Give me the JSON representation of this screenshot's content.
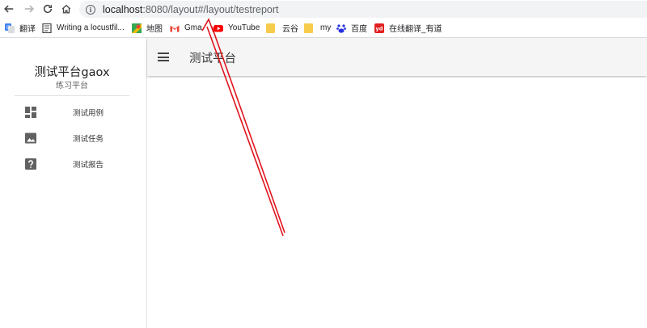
{
  "browser": {
    "url_host": "localhost",
    "url_rest": ":8080/layout#/layout/testreport",
    "bookmarks": [
      {
        "label": "翻译",
        "icon": "google-translate-icon"
      },
      {
        "label": "Writing a locustfil...",
        "icon": "document-icon"
      },
      {
        "label": "地图",
        "icon": "google-maps-icon"
      },
      {
        "label": "Gma",
        "icon": "gmail-icon"
      },
      {
        "label": "YouTube",
        "icon": "youtube-icon"
      },
      {
        "label": "云谷",
        "icon": "folder-icon"
      },
      {
        "label": "my",
        "icon": "folder-icon"
      },
      {
        "label": "百度",
        "icon": "baidu-icon"
      },
      {
        "label": "在线翻译_有道",
        "icon": "youdao-icon"
      }
    ]
  },
  "sidebar": {
    "title": "测试平台gaox",
    "subtitle": "练习平台",
    "items": [
      {
        "label": "测试用例",
        "icon": "dashboard-icon"
      },
      {
        "label": "测试任务",
        "icon": "image-icon"
      },
      {
        "label": "测试报告",
        "icon": "help-icon"
      }
    ]
  },
  "header": {
    "title": "测试平台"
  },
  "colors": {
    "annotation_arrow": "#e0141e",
    "header_bg": "#f5f5f5"
  }
}
